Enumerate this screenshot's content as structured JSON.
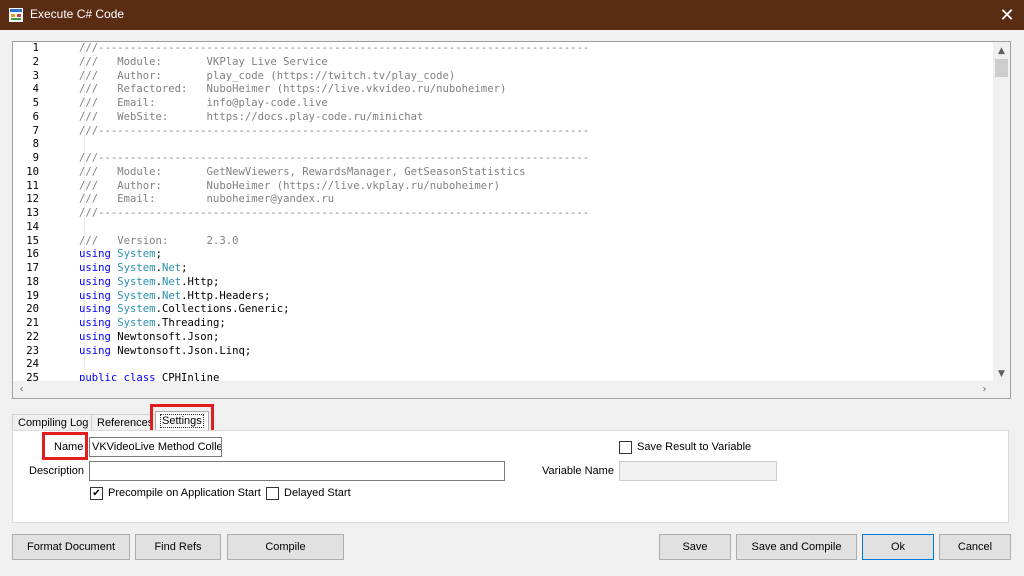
{
  "window": {
    "title": "Execute C# Code",
    "close_glyph": "✕"
  },
  "editor": {
    "lines": [
      {
        "n": "1",
        "parts": [
          [
            "c",
            "///-----------------------------------------------------------------------------"
          ]
        ]
      },
      {
        "n": "2",
        "parts": [
          [
            "c",
            "///   Module:       VKPlay Live Service"
          ]
        ]
      },
      {
        "n": "3",
        "parts": [
          [
            "c",
            "///   Author:       play_code (https://twitch.tv/play_code)"
          ]
        ]
      },
      {
        "n": "4",
        "parts": [
          [
            "c",
            "///   Refactored:   NuboHeimer (https://live.vkvideo.ru/nuboheimer)"
          ]
        ]
      },
      {
        "n": "5",
        "parts": [
          [
            "c",
            "///   Email:        info@play-code.live"
          ]
        ]
      },
      {
        "n": "6",
        "parts": [
          [
            "c",
            "///   WebSite:      https://docs.play-code.ru/minichat"
          ]
        ]
      },
      {
        "n": "7",
        "parts": [
          [
            "c",
            "///-----------------------------------------------------------------------------"
          ]
        ]
      },
      {
        "n": "8",
        "parts": []
      },
      {
        "n": "9",
        "parts": [
          [
            "c",
            "///-----------------------------------------------------------------------------"
          ]
        ]
      },
      {
        "n": "10",
        "parts": [
          [
            "c",
            "///   Module:       GetNewViewers, RewardsManager, GetSeasonStatistics"
          ]
        ]
      },
      {
        "n": "11",
        "parts": [
          [
            "c",
            "///   Author:       NuboHeimer (https://live.vkplay.ru/nuboheimer)"
          ]
        ]
      },
      {
        "n": "12",
        "parts": [
          [
            "c",
            "///   Email:        nuboheimer@yandex.ru"
          ]
        ]
      },
      {
        "n": "13",
        "parts": [
          [
            "c",
            "///-----------------------------------------------------------------------------"
          ]
        ]
      },
      {
        "n": "14",
        "parts": []
      },
      {
        "n": "15",
        "parts": [
          [
            "c",
            "///   Version:      2.3.0"
          ]
        ]
      },
      {
        "n": "16",
        "parts": [
          [
            "k",
            "using "
          ],
          [
            "t",
            "System"
          ],
          [
            "n",
            ";"
          ]
        ]
      },
      {
        "n": "17",
        "parts": [
          [
            "k",
            "using "
          ],
          [
            "t",
            "System"
          ],
          [
            "n",
            "."
          ],
          [
            "t",
            "Net"
          ],
          [
            "n",
            ";"
          ]
        ]
      },
      {
        "n": "18",
        "parts": [
          [
            "k",
            "using "
          ],
          [
            "t",
            "System"
          ],
          [
            "n",
            "."
          ],
          [
            "t",
            "Net"
          ],
          [
            "n",
            ".Http;"
          ]
        ]
      },
      {
        "n": "19",
        "parts": [
          [
            "k",
            "using "
          ],
          [
            "t",
            "System"
          ],
          [
            "n",
            "."
          ],
          [
            "t",
            "Net"
          ],
          [
            "n",
            ".Http.Headers;"
          ]
        ]
      },
      {
        "n": "20",
        "parts": [
          [
            "k",
            "using "
          ],
          [
            "t",
            "System"
          ],
          [
            "n",
            ".Collections.Generic;"
          ]
        ]
      },
      {
        "n": "21",
        "parts": [
          [
            "k",
            "using "
          ],
          [
            "t",
            "System"
          ],
          [
            "n",
            ".Threading;"
          ]
        ]
      },
      {
        "n": "22",
        "parts": [
          [
            "k",
            "using "
          ],
          [
            "n",
            "Newtonsoft.Json;"
          ]
        ]
      },
      {
        "n": "23",
        "parts": [
          [
            "k",
            "using "
          ],
          [
            "n",
            "Newtonsoft.Json.Linq;"
          ]
        ]
      },
      {
        "n": "24",
        "parts": []
      },
      {
        "n": "25",
        "parts": [
          [
            "k",
            "public class "
          ],
          [
            "n",
            "CPHInline"
          ]
        ]
      }
    ]
  },
  "tabs": [
    {
      "label": "Compiling Log",
      "active": false
    },
    {
      "label": "References",
      "active": false
    },
    {
      "label": "Settings",
      "active": true
    }
  ],
  "settings": {
    "name_label": "Name",
    "name_value": "VKVideoLive Method Collection",
    "description_label": "Description",
    "description_value": "",
    "precompile_label": "Precompile on Application Start",
    "precompile_checked": true,
    "delayed_label": "Delayed Start",
    "delayed_checked": false,
    "save_result_label": "Save Result to Variable",
    "save_result_checked": false,
    "variable_name_label": "Variable Name",
    "variable_name_value": ""
  },
  "buttons": {
    "format": "Format Document",
    "find_refs": "Find Refs",
    "compile": "Compile",
    "save": "Save",
    "save_compile": "Save and Compile",
    "ok": "Ok",
    "cancel": "Cancel"
  },
  "colors": {
    "titlebar": "#5b2c14",
    "highlight": "#e01e1e",
    "keyword": "#0000ff",
    "type": "#2b91af",
    "comment": "#808080"
  }
}
